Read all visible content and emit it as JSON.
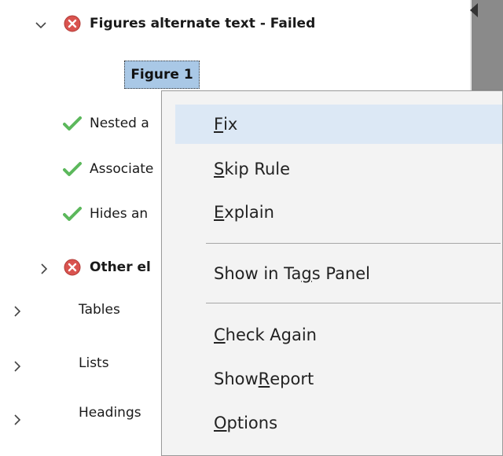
{
  "tree": {
    "figures_group": {
      "label": "Figures alternate text - Failed",
      "expanded": true
    },
    "selected_child": {
      "label": "Figure 1"
    },
    "passed_rules": [
      {
        "label": "Nested a"
      },
      {
        "label": "Associate"
      },
      {
        "label": "Hides an"
      }
    ],
    "other_group": {
      "label": "Other el"
    },
    "sections": [
      {
        "label": "Tables"
      },
      {
        "label": "Lists"
      },
      {
        "label": "Headings"
      }
    ]
  },
  "context_menu": {
    "items": [
      {
        "pre": "",
        "key": "F",
        "post": "ix"
      },
      {
        "pre": "",
        "key": "S",
        "post": "kip Rule"
      },
      {
        "pre": "",
        "key": "E",
        "post": "xplain"
      },
      {
        "pre": "Show in Ta",
        "key": "g",
        "post": "s Panel"
      },
      {
        "pre": "",
        "key": "C",
        "post": "heck Again"
      },
      {
        "pre": "Show ",
        "key": "R",
        "post": "eport"
      },
      {
        "pre": "",
        "key": "O",
        "post": "ptions"
      }
    ]
  },
  "colors": {
    "fail_red": "#d9534f",
    "pass_green": "#5cb85c",
    "selection_bg": "#a9c8e6",
    "menu_bg": "#f3f3f3",
    "menu_highlight": "#dce8f5"
  }
}
